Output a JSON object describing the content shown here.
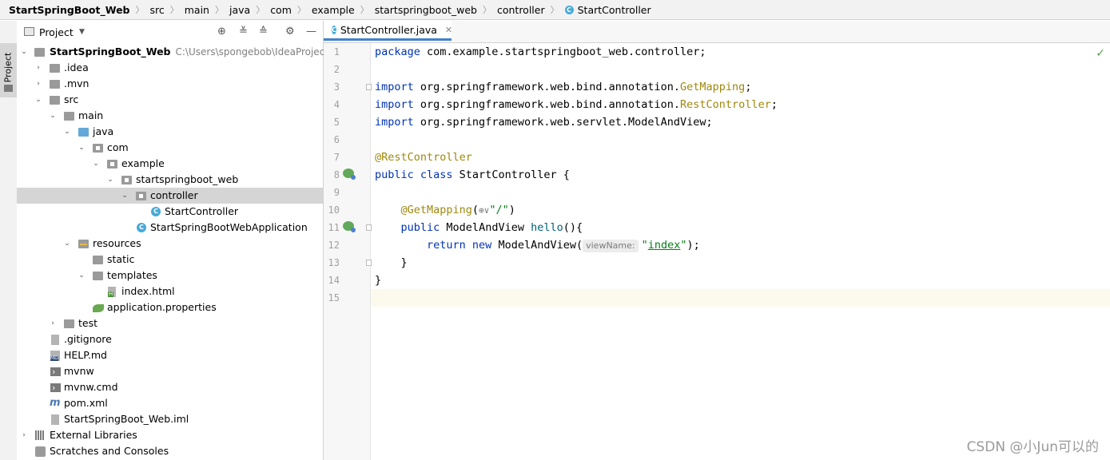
{
  "breadcrumb": {
    "items": [
      "StartSpringBoot_Web",
      "src",
      "main",
      "java",
      "com",
      "example",
      "startspringboot_web",
      "controller",
      "StartController"
    ]
  },
  "sidebar": {
    "project_tab": "Project"
  },
  "panel": {
    "title": "Project"
  },
  "tree": [
    {
      "label": "StartSpringBoot_Web",
      "path": "C:\\Users\\spongebob\\IdeaProjects\\"
    },
    {
      "label": ".idea"
    },
    {
      "label": ".mvn"
    },
    {
      "label": "src"
    },
    {
      "label": "main"
    },
    {
      "label": "java"
    },
    {
      "label": "com"
    },
    {
      "label": "example"
    },
    {
      "label": "startspringboot_web"
    },
    {
      "label": "controller"
    },
    {
      "label": "StartController"
    },
    {
      "label": "StartSpringBootWebApplication"
    },
    {
      "label": "resources"
    },
    {
      "label": "static"
    },
    {
      "label": "templates"
    },
    {
      "label": "index.html"
    },
    {
      "label": "application.properties"
    },
    {
      "label": "test"
    },
    {
      "label": ".gitignore"
    },
    {
      "label": "HELP.md"
    },
    {
      "label": "mvnw"
    },
    {
      "label": "mvnw.cmd"
    },
    {
      "label": "pom.xml"
    },
    {
      "label": "StartSpringBoot_Web.iml"
    },
    {
      "label": "External Libraries"
    },
    {
      "label": "Scratches and Consoles"
    }
  ],
  "editor": {
    "tab_label": "StartController.java",
    "line_numbers": [
      "1",
      "2",
      "3",
      "4",
      "5",
      "6",
      "7",
      "8",
      "9",
      "10",
      "11",
      "12",
      "13",
      "14",
      "15"
    ],
    "code": {
      "l1_kw": "package",
      "l1_rest": " com.example.startspringboot_web.controller;",
      "l3_kw": "import",
      "l3_pkg": " org.springframework.web.bind.annotation.",
      "l3_cls": "GetMapping",
      "l3_end": ";",
      "l4_kw": "import",
      "l4_pkg": " org.springframework.web.bind.annotation.",
      "l4_cls": "RestController",
      "l4_end": ";",
      "l5_kw": "import",
      "l5_rest": " org.springframework.web.servlet.ModelAndView;",
      "l7_ann": "@RestController",
      "l8_kw": "public class",
      "l8_rest": " StartController {",
      "l10_ann": "@GetMapping",
      "l10_open": "(",
      "l10_icon": "⊕∨",
      "l10_str": "\"/\"",
      "l10_close": ")",
      "l11_kw": "public",
      "l11_type": " ModelAndView ",
      "l11_fn": "hello",
      "l11_rest": "(){",
      "l12_kw": "return new",
      "l12_rest": " ModelAndView(",
      "l12_hint": "viewName:",
      "l12_q1": "\"",
      "l12_str": "index",
      "l12_q2": "\"",
      "l12_end": ");",
      "l13": "}",
      "l14": "}"
    }
  },
  "watermark": "CSDN @小Jun可以的"
}
